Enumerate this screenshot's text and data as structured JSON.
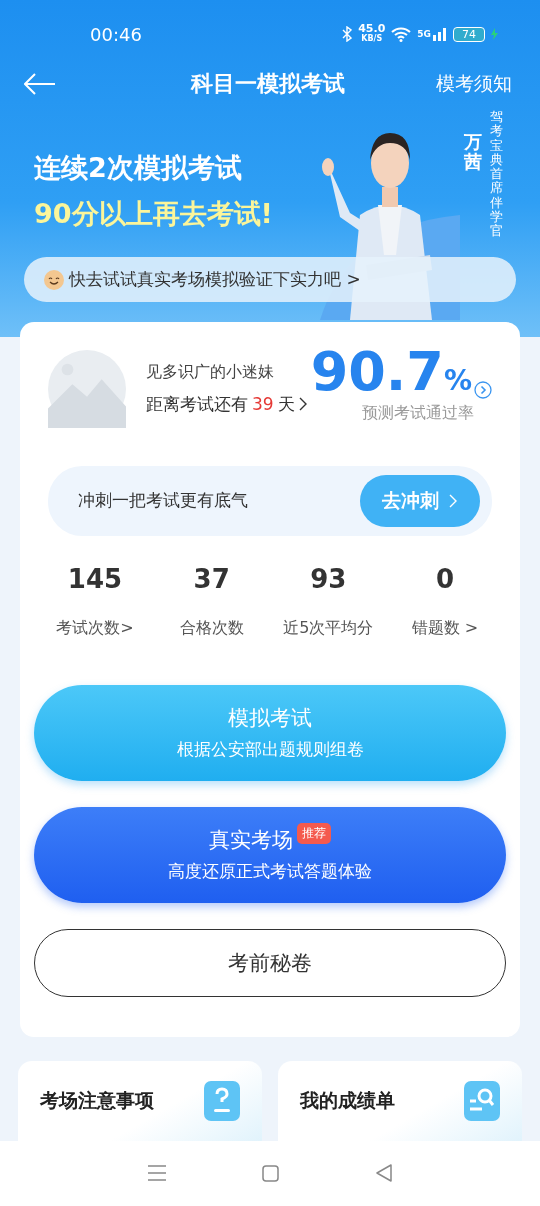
{
  "status_bar": {
    "time": "00:46",
    "speed": "45.0",
    "speed_unit": "KB/S",
    "network": "5G",
    "battery": "74"
  },
  "nav": {
    "title": "科目一模拟考试",
    "action": "模考须知"
  },
  "banner": {
    "line1": "连续2次模拟考试",
    "line2": "90分以上再去考试!",
    "name": "万茜",
    "role": "驾考宝典首席伴学官",
    "tip": "快去试试真实考场模拟验证下实力吧 >"
  },
  "profile": {
    "name": "见多识广的小迷妹",
    "countdown_prefix": "距离考试还有",
    "countdown_days": "39",
    "countdown_suffix": "天",
    "rate": "90.7",
    "rate_unit": "%",
    "rate_label": "预测考试通过率"
  },
  "sprint": {
    "text": "冲刺一把考试更有底气",
    "button": "去冲刺"
  },
  "stats": [
    {
      "value": "145",
      "label": "考试次数>"
    },
    {
      "value": "37",
      "label": "合格次数"
    },
    {
      "value": "93",
      "label": "近5次平均分"
    },
    {
      "value": "0",
      "label": "错题数 >"
    }
  ],
  "buttons": [
    {
      "kind": "light",
      "title": "模拟考试",
      "subtitle": "根据公安部出题规则组卷"
    },
    {
      "kind": "dark",
      "title": "真实考场",
      "badge": "推荐",
      "subtitle": "高度还原正式考试答题体验"
    },
    {
      "kind": "outline",
      "title": "考前秘卷"
    }
  ],
  "tiles": [
    {
      "kind": "help",
      "title": "考场注意事项"
    },
    {
      "kind": "report",
      "title": "我的成绩单"
    }
  ]
}
